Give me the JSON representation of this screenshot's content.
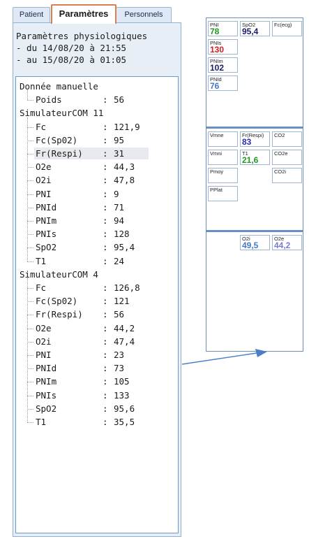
{
  "tabs": [
    {
      "label": "Patient",
      "active": false
    },
    {
      "label": "Paramètres",
      "active": true
    },
    {
      "label": "Personnels",
      "active": false
    }
  ],
  "period": {
    "title": "Paramètres physiologiques",
    "from": "- du 14/08/20 à 21:55",
    "to": "- au 15/08/20 à 01:05"
  },
  "tree": {
    "groups": [
      {
        "name": "Donnée manuelle",
        "params": [
          {
            "name": "Poids",
            "value": "56"
          }
        ]
      },
      {
        "name": "SimulateurCOM 11",
        "params": [
          {
            "name": "Fc",
            "value": "121,9"
          },
          {
            "name": "Fc(Sp02)",
            "value": "95"
          },
          {
            "name": "Fr(Respi)",
            "value": "31",
            "selected": true
          },
          {
            "name": "O2e",
            "value": "44,3"
          },
          {
            "name": "O2i",
            "value": "47,8"
          },
          {
            "name": "PNI",
            "value": "9"
          },
          {
            "name": "PNId",
            "value": "71"
          },
          {
            "name": "PNIm",
            "value": "94"
          },
          {
            "name": "PNIs",
            "value": "128"
          },
          {
            "name": "SpO2",
            "value": "95,4"
          },
          {
            "name": "T1",
            "value": "24"
          }
        ]
      },
      {
        "name": "SimulateurCOM 4",
        "params": [
          {
            "name": "Fc",
            "value": "126,8"
          },
          {
            "name": "Fc(Sp02)",
            "value": "121"
          },
          {
            "name": "Fr(Respi)",
            "value": "56"
          },
          {
            "name": "O2e",
            "value": "44,2"
          },
          {
            "name": "O2i",
            "value": "47,4"
          },
          {
            "name": "PNI",
            "value": "23"
          },
          {
            "name": "PNId",
            "value": "73"
          },
          {
            "name": "PNIm",
            "value": "105"
          },
          {
            "name": "PNIs",
            "value": "133"
          },
          {
            "name": "SpO2",
            "value": "95,6"
          },
          {
            "name": "T1",
            "value": "35,5"
          }
        ]
      }
    ]
  },
  "monitor": {
    "sections": [
      {
        "cells": [
          {
            "label": "PNI",
            "value": "78",
            "color": "#1e9a1e",
            "col": 0,
            "row": 0
          },
          {
            "label": "SpO2",
            "value": "95,4",
            "color": "#1a1a66",
            "col": 1,
            "row": 0
          },
          {
            "label": "Fc(ecg)",
            "value": "",
            "color": "#1a1a1a",
            "col": 2,
            "row": 0
          },
          {
            "label": "PNIs",
            "value": "130",
            "color": "#cc1f1f",
            "col": 0,
            "row": 1
          },
          {
            "label": "PNIm",
            "value": "102",
            "color": "#1a1a66",
            "col": 0,
            "row": 2
          },
          {
            "label": "PNId",
            "value": "76",
            "color": "#3d7ac8",
            "col": 0,
            "row": 3
          }
        ]
      },
      {
        "cells": [
          {
            "label": "Vmne",
            "value": "",
            "color": "#1a1a1a",
            "col": 0,
            "row": 0
          },
          {
            "label": "Fr(Respi)",
            "value": "83",
            "color": "#2a2ab8",
            "col": 1,
            "row": 0
          },
          {
            "label": "CO2",
            "value": "",
            "color": "#1a1a1a",
            "col": 2,
            "row": 0
          },
          {
            "label": "Vmni",
            "value": "",
            "color": "#1a1a1a",
            "col": 0,
            "row": 1
          },
          {
            "label": "T1",
            "value": "21,6",
            "color": "#1e9a1e",
            "col": 1,
            "row": 1
          },
          {
            "label": "CO2e",
            "value": "",
            "color": "#1a1a1a",
            "col": 2,
            "row": 1
          },
          {
            "label": "Pmoy",
            "value": "",
            "color": "#1a1a1a",
            "col": 0,
            "row": 2
          },
          {
            "label": "CO2i",
            "value": "",
            "color": "#1a1a1a",
            "col": 2,
            "row": 2
          },
          {
            "label": "PPlat",
            "value": "",
            "color": "#1a1a1a",
            "col": 0,
            "row": 3
          }
        ]
      },
      {
        "cells": [
          {
            "label": "O2i",
            "value": "49,5",
            "color": "#3d7ac8",
            "col": 1,
            "row": 0
          },
          {
            "label": "O2e",
            "value": "44,2",
            "color": "#7a7ad8",
            "col": 2,
            "row": 0
          }
        ]
      }
    ]
  },
  "colors": {
    "active_tab_border": "#e27b52",
    "panel_border": "#8fb0d8",
    "arrow": "#4a7fc8"
  }
}
